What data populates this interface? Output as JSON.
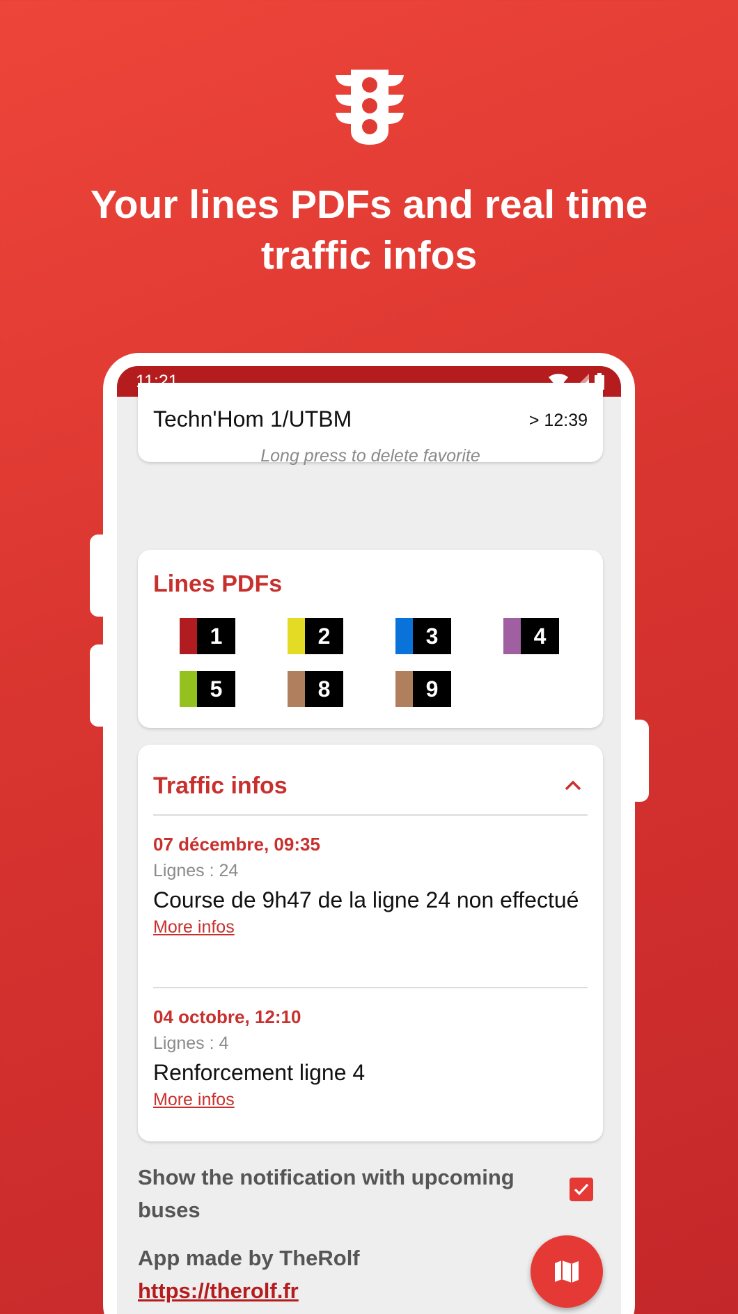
{
  "headline": "Your lines PDFs and real time traffic infos",
  "status_bar": {
    "time": "11:21"
  },
  "favorite": {
    "stop": "Techn'Hom 1/UTBM",
    "next_time": "> 12:39",
    "hint": "Long press to delete favorite"
  },
  "lines_pdfs": {
    "title": "Lines PDFs",
    "lines": [
      {
        "number": "1",
        "color": "#b01c20"
      },
      {
        "number": "2",
        "color": "#e4db24"
      },
      {
        "number": "3",
        "color": "#0a73d9"
      },
      {
        "number": "4",
        "color": "#a05fa0"
      },
      {
        "number": "5",
        "color": "#95c11f"
      },
      {
        "number": "8",
        "color": "#b0805e"
      },
      {
        "number": "9",
        "color": "#b0805e"
      }
    ]
  },
  "traffic": {
    "title": "Traffic infos",
    "items": [
      {
        "date": "07 décembre, 09:35",
        "lines": "Lignes : 24",
        "text": "Course de 9h47 de la ligne 24 non effectué",
        "link": "More infos"
      },
      {
        "date": "04 octobre, 12:10",
        "lines": "Lignes : 4",
        "text": "Renforcement ligne 4",
        "link": "More infos"
      }
    ]
  },
  "settings": {
    "notification_label": "Show the notification with upcoming buses",
    "notification_checked": true
  },
  "footer": {
    "made_by": "App made by TheRolf",
    "url": "https://therolf.fr"
  },
  "icons": {
    "hero": "traffic-light-icon",
    "fab": "map-icon"
  }
}
